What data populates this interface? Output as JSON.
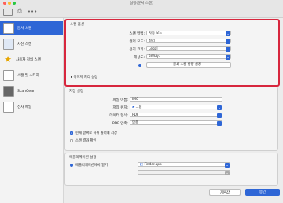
{
  "window": {
    "title": "설정(문서 스캔)"
  },
  "sidebar": {
    "items": [
      {
        "label": "문서 스캔",
        "selected": true
      },
      {
        "label": "사진 스캔"
      },
      {
        "label": "사용자 정의 스캔"
      },
      {
        "label": "스캔 및 스티치"
      },
      {
        "label": "ScanGear"
      },
      {
        "label": "전자 메일"
      }
    ]
  },
  "scan_options": {
    "title": "스캔 옵션",
    "source_label": "스캔 방법:",
    "source_value": "자동 모드",
    "color_label": "컬러 모드:",
    "color_value": "컬러",
    "paper_label": "용지 크기:",
    "paper_value": "Legal",
    "resolution_label": "해상도:",
    "resolution_value": "300dpi",
    "orientation_button": "문서 스캔 방향 설정...",
    "image_settings": "이미지 처리 설정"
  },
  "save_settings": {
    "title": "저장 설정",
    "filename_label": "파일 이름:",
    "filename_value": "IMG",
    "save_in_label": "저장 위치:",
    "save_in_value": "그림",
    "format_label": "데이터 형식:",
    "format_value": "PDF",
    "pdf_label": "PDF 압축:",
    "pdf_value": "압축",
    "subfolder_label": "현재 날짜로 하위 폴더에 저장",
    "check_results_label": "스캔 결과 확인"
  },
  "app_settings": {
    "title": "애플리케이션 설정",
    "open_with_label": "애플리케이션에서 열기:",
    "open_with_value": "Finder.app"
  },
  "footer": {
    "defaults_label": "기본값",
    "ok_label": "승인"
  },
  "colors": {
    "accent": "#2e66d6",
    "highlight": "#d7263d"
  }
}
